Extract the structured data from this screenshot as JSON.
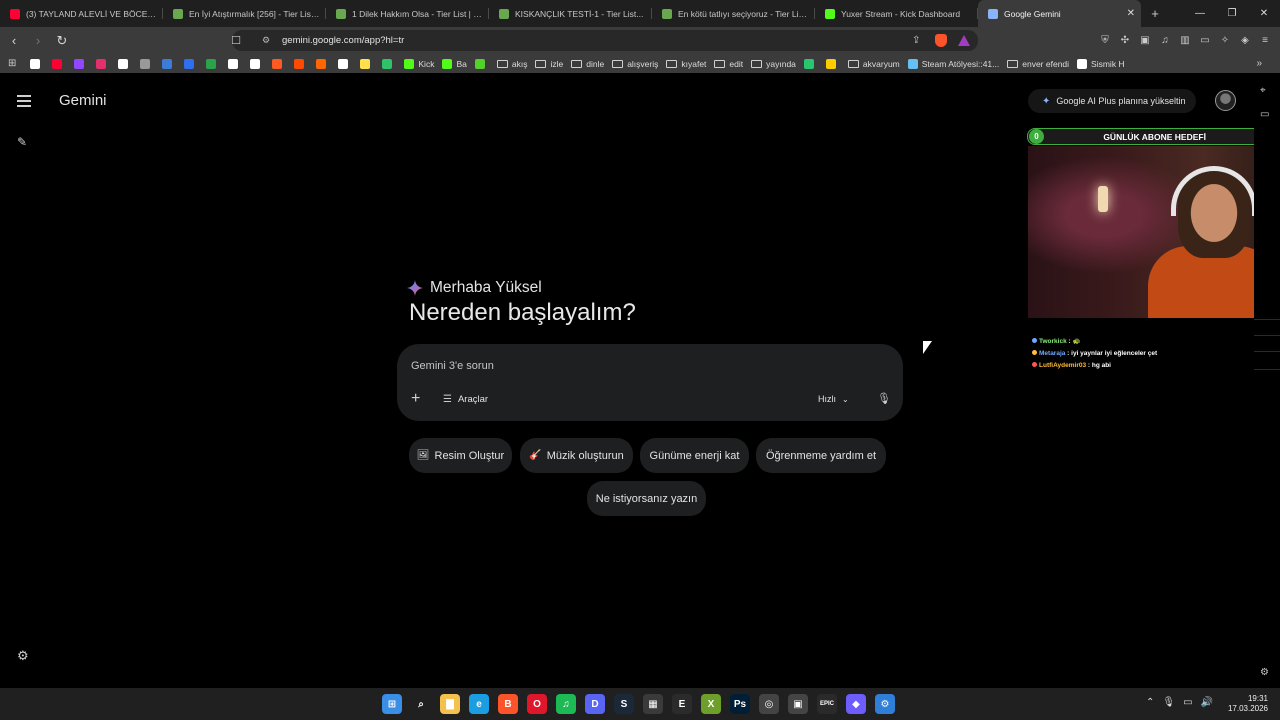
{
  "browser": {
    "tabs": [
      {
        "title": "(3) TAYLAND ALEVLİ VE BÖCEKLİ SO...",
        "favicon_color": "#ff0033"
      },
      {
        "title": "En İyi Atıştırmalık [256] - Tier List | Kö...",
        "favicon_color": "#6aa84f"
      },
      {
        "title": "1 Dilek Hakkım Olsa - Tier List | Kör S...",
        "favicon_color": "#6aa84f"
      },
      {
        "title": "KISKANÇLIK TESTİ-1 - Tier List...",
        "favicon_color": "#6aa84f"
      },
      {
        "title": "En kötü tatlıyı seçiyoruz - Tier List | K...",
        "favicon_color": "#6aa84f"
      },
      {
        "title": "Yuxer Stream - Kick Dashboard",
        "favicon_color": "#53fc18"
      },
      {
        "title": "Google Gemini",
        "favicon_color": "#8ab4f8",
        "active": true
      }
    ],
    "new_tab": "+",
    "window_controls": [
      "—",
      "❐",
      "✕"
    ],
    "url": "gemini.google.com/app?hl=tr",
    "bookmarks": [
      {
        "label": "",
        "color": "#ffffff"
      },
      {
        "label": "",
        "color": "#ff0033"
      },
      {
        "label": "",
        "color": "#9146ff"
      },
      {
        "label": "",
        "color": "#e1306c"
      },
      {
        "label": "",
        "color": "#ffffff"
      },
      {
        "label": "",
        "color": "#999999"
      },
      {
        "label": "",
        "color": "#3d7bd9"
      },
      {
        "label": "",
        "color": "#2f6fed"
      },
      {
        "label": "",
        "color": "#2aa34a"
      },
      {
        "label": "",
        "color": "#ffffff"
      },
      {
        "label": "",
        "color": "#ffffff"
      },
      {
        "label": "",
        "color": "#ff5a1f"
      },
      {
        "label": "",
        "color": "#ff4b00"
      },
      {
        "label": "",
        "color": "#ff6600"
      },
      {
        "label": "",
        "color": "#ffffff"
      },
      {
        "label": "",
        "color": "#ffe14d"
      },
      {
        "label": "",
        "color": "#2ec26a"
      },
      {
        "label": "Kick",
        "color": "#53fc18"
      },
      {
        "label": "Ba",
        "color": "#53fc18"
      },
      {
        "label": "",
        "color": "#53d02a"
      },
      {
        "label": "akış",
        "folder": true
      },
      {
        "label": "izle",
        "folder": true
      },
      {
        "label": "dinle",
        "folder": true
      },
      {
        "label": "alışveriş",
        "folder": true
      },
      {
        "label": "kıyafet",
        "folder": true
      },
      {
        "label": "edit",
        "folder": true
      },
      {
        "label": "yayında",
        "folder": true
      },
      {
        "label": "",
        "color": "#28c76f"
      },
      {
        "label": "",
        "color": "#ffcc00"
      },
      {
        "label": "akvaryum",
        "folder": true
      },
      {
        "label": "Steam Atölyesi::41...",
        "color": "#66c0f4"
      },
      {
        "label": "enver efendi",
        "folder": true
      },
      {
        "label": "Sismik H",
        "color": "#ffffff"
      }
    ],
    "bookmarks_more": "»"
  },
  "app": {
    "name": "Gemini",
    "upgrade_label": "Google AI Plus planına yükseltin",
    "greeting": "Merhaba Yüksel",
    "headline": "Nereden başlayalım?",
    "prompt_placeholder": "Gemini 3'e sorun",
    "tools_label": "Araçlar",
    "mode_label": "Hızlı",
    "suggestions": [
      {
        "label": "Resim Oluştur",
        "icon": "🖼"
      },
      {
        "label": "Müzik oluşturun",
        "icon": "🎸"
      },
      {
        "label": "Günüme enerji kat",
        "icon": ""
      },
      {
        "label": "Öğrenmeme yardım et",
        "icon": ""
      },
      {
        "label": "Ne istiyorsanız yazın",
        "icon": ""
      }
    ]
  },
  "overlay": {
    "goal_title": "GÜNLÜK ABONE HEDEFİ",
    "goal_current": "0",
    "goal_target": "6",
    "chat": [
      {
        "user": "Tworkick",
        "text": " : 🐢",
        "user_color": "#8bf07a"
      },
      {
        "user": "Metaraja",
        "text": " : iyi yaynlar iyi eğlenceler çet",
        "user_color": "#6fa9ff"
      },
      {
        "user": "LutfiAydemir03",
        "text": " : hg abi",
        "user_color": "#ffbe3b"
      }
    ]
  },
  "taskbar": {
    "time": "19:31",
    "date": "17.03.2026",
    "apps": [
      {
        "name": "windows-start",
        "glyph": "⊞",
        "color": "#3a8ee6"
      },
      {
        "name": "search",
        "glyph": "⌕",
        "color": "#202020"
      },
      {
        "name": "file-explorer",
        "glyph": "▇",
        "color": "#f2c14e"
      },
      {
        "name": "edge",
        "glyph": "e",
        "color": "#1b9de2"
      },
      {
        "name": "brave",
        "glyph": "B",
        "color": "#fb542b"
      },
      {
        "name": "opera",
        "glyph": "O",
        "color": "#e0162b"
      },
      {
        "name": "spotify",
        "glyph": "♫",
        "color": "#1db954"
      },
      {
        "name": "discord",
        "glyph": "D",
        "color": "#5865f2"
      },
      {
        "name": "steam",
        "glyph": "S",
        "color": "#1b2838"
      },
      {
        "name": "calculator",
        "glyph": "▦",
        "color": "#3a3a3a"
      },
      {
        "name": "epic-app",
        "glyph": "E",
        "color": "#2b2b2b"
      },
      {
        "name": "xbox-app",
        "glyph": "X",
        "color": "#6e9f2a"
      },
      {
        "name": "photoshop",
        "glyph": "Ps",
        "color": "#001e36"
      },
      {
        "name": "chrome-app",
        "glyph": "◎",
        "color": "#444444"
      },
      {
        "name": "obs-app",
        "glyph": "▣",
        "color": "#444444"
      },
      {
        "name": "epic-games",
        "glyph": "EPIC",
        "color": "#2a2a2a"
      },
      {
        "name": "vs-app",
        "glyph": "◆",
        "color": "#6d5dfc"
      },
      {
        "name": "settings-app",
        "glyph": "⚙",
        "color": "#2f7fd8"
      }
    ]
  }
}
